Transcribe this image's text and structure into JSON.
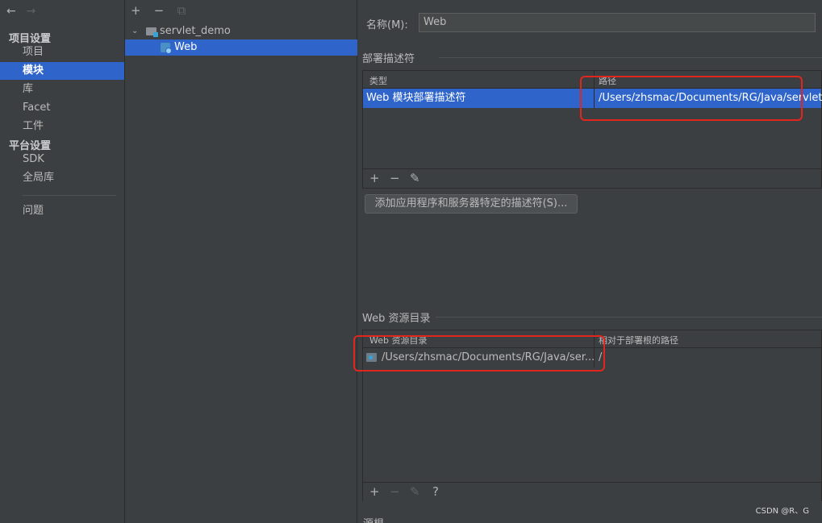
{
  "nav": {
    "back_icon": "←",
    "forward_icon": "→",
    "project_settings": "项目设置",
    "items_project": [
      "项目",
      "模块",
      "库",
      "Facet",
      "工件"
    ],
    "platform_settings": "平台设置",
    "items_platform": [
      "SDK",
      "全局库"
    ],
    "problems": "问题",
    "selected": "模块"
  },
  "tree": {
    "toolbar": {
      "add": "+",
      "remove": "−",
      "copy": "⧉"
    },
    "root": "servlet_demo",
    "child": "Web"
  },
  "main": {
    "name_label": "名称(M):",
    "name_value": "Web",
    "deploy_section": "部署描述符",
    "deploy_table": {
      "col_type": "类型",
      "col_path": "路径",
      "row_type": "Web 模块部署描述符",
      "row_path": "/Users/zhsmac/Documents/RG/Java/servlet_d"
    },
    "deploy_toolbar": {
      "add": "+",
      "remove": "−",
      "edit": "✎"
    },
    "add_descriptor_button": "添加应用程序和服务器特定的描述符(S)...",
    "web_res_section": "Web 资源目录",
    "res_table": {
      "col_dir": "Web 资源目录",
      "col_rel": "相对于部署根的路径",
      "row_dir": "/Users/zhsmac/Documents/RG/Java/ser...",
      "row_rel": "/"
    },
    "res_toolbar": {
      "add": "+",
      "remove": "−",
      "edit": "✎",
      "help": "?"
    },
    "source_root_label": "源根"
  },
  "watermark": "CSDN @R、G",
  "colors": {
    "selection": "#2f65ca",
    "highlight_box": "#e0261d",
    "background": "#3c3f41"
  }
}
